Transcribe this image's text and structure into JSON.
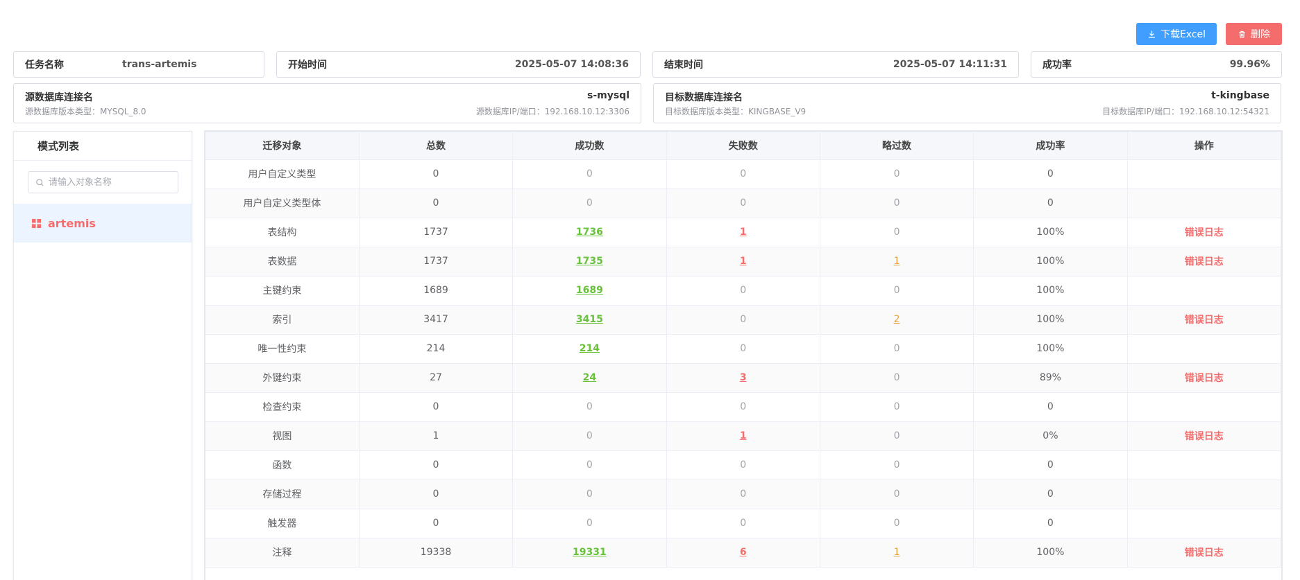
{
  "toolbar": {
    "excel_label": "下载Excel",
    "delete_label": "删除"
  },
  "task": {
    "name_label": "任务名称",
    "name_value": "trans-artemis",
    "start_label": "开始时间",
    "start_value": "2025-05-07 14:08:36",
    "end_label": "结束时间",
    "end_value": "2025-05-07 14:11:31",
    "rate_label": "成功率",
    "rate_value": "99.96%"
  },
  "source": {
    "conn_label": "源数据库连接名",
    "conn_value": "s-mysql",
    "version_label": "源数据库版本类型：",
    "version_value": "MYSQL_8.0",
    "ip_label": "源数据库IP/端口：",
    "ip_value": "192.168.10.12:3306"
  },
  "target": {
    "conn_label": "目标数据库连接名",
    "conn_value": "t-kingbase",
    "version_label": "目标数据库版本类型：",
    "version_value": "KINGBASE_V9",
    "ip_label": "目标数据库IP/端口：",
    "ip_value": "192.168.10.12:54321"
  },
  "sidebar": {
    "title": "模式列表",
    "search_placeholder": "请输入对象名称",
    "items": [
      {
        "label": "artemis",
        "icon": "grid-icon"
      }
    ]
  },
  "table": {
    "headers": [
      "迁移对象",
      "总数",
      "成功数",
      "失败数",
      "略过数",
      "成功率",
      "操作"
    ],
    "rows": [
      {
        "object": "用户自定义类型",
        "total": "0",
        "success": "0",
        "fail": "0",
        "skip": "0",
        "rate": "0",
        "action": ""
      },
      {
        "object": "用户自定义类型体",
        "total": "0",
        "success": "0",
        "fail": "0",
        "skip": "0",
        "rate": "0",
        "action": ""
      },
      {
        "object": "表结构",
        "total": "1737",
        "success": "1736",
        "fail": "1",
        "skip": "0",
        "rate": "100%",
        "action": "错误日志"
      },
      {
        "object": "表数据",
        "total": "1737",
        "success": "1735",
        "fail": "1",
        "skip": "1",
        "rate": "100%",
        "action": "错误日志"
      },
      {
        "object": "主键约束",
        "total": "1689",
        "success": "1689",
        "fail": "0",
        "skip": "0",
        "rate": "100%",
        "action": ""
      },
      {
        "object": "索引",
        "total": "3417",
        "success": "3415",
        "fail": "0",
        "skip": "2",
        "rate": "100%",
        "action": "错误日志"
      },
      {
        "object": "唯一性约束",
        "total": "214",
        "success": "214",
        "fail": "0",
        "skip": "0",
        "rate": "100%",
        "action": ""
      },
      {
        "object": "外键约束",
        "total": "27",
        "success": "24",
        "fail": "3",
        "skip": "0",
        "rate": "89%",
        "action": "错误日志"
      },
      {
        "object": "检查约束",
        "total": "0",
        "success": "0",
        "fail": "0",
        "skip": "0",
        "rate": "0",
        "action": ""
      },
      {
        "object": "视图",
        "total": "1",
        "success": "0",
        "fail": "1",
        "skip": "0",
        "rate": "0%",
        "action": "错误日志"
      },
      {
        "object": "函数",
        "total": "0",
        "success": "0",
        "fail": "0",
        "skip": "0",
        "rate": "0",
        "action": ""
      },
      {
        "object": "存储过程",
        "total": "0",
        "success": "0",
        "fail": "0",
        "skip": "0",
        "rate": "0",
        "action": ""
      },
      {
        "object": "触发器",
        "total": "0",
        "success": "0",
        "fail": "0",
        "skip": "0",
        "rate": "0",
        "action": ""
      },
      {
        "object": "注释",
        "total": "19338",
        "success": "19331",
        "fail": "6",
        "skip": "1",
        "rate": "100%",
        "action": "错误日志"
      }
    ]
  }
}
